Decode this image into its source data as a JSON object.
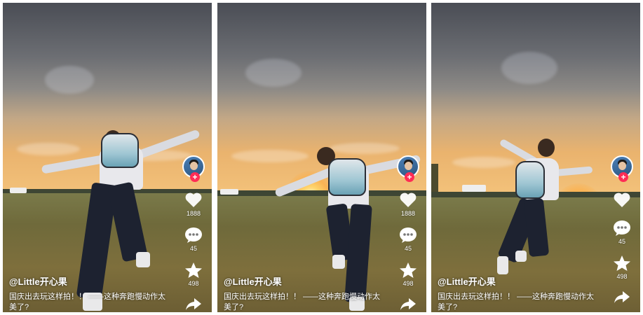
{
  "panels": [
    {
      "username": "@Little开心果",
      "caption": "国庆出去玩这样拍！！ ——这种奔跑慢动作太美了?",
      "likes": "1888",
      "comments": "45",
      "favorites": "498"
    },
    {
      "username": "@Little开心果",
      "caption": "国庆出去玩这样拍！！ ——这种奔跑慢动作太美了?",
      "likes": "1888",
      "comments": "45",
      "favorites": "498"
    },
    {
      "username": "@Little开心果",
      "caption": "国庆出去玩这样拍！！ ——这种奔跑慢动作太美了?",
      "likes": "",
      "comments": "45",
      "favorites": "498"
    }
  ],
  "icons": {
    "like": "heart-icon",
    "comment": "comment-icon",
    "favorite": "star-icon",
    "share": "share-icon",
    "follow": "plus-icon"
  },
  "colors": {
    "follow": "#fe2c55",
    "text": "#ffffff"
  }
}
